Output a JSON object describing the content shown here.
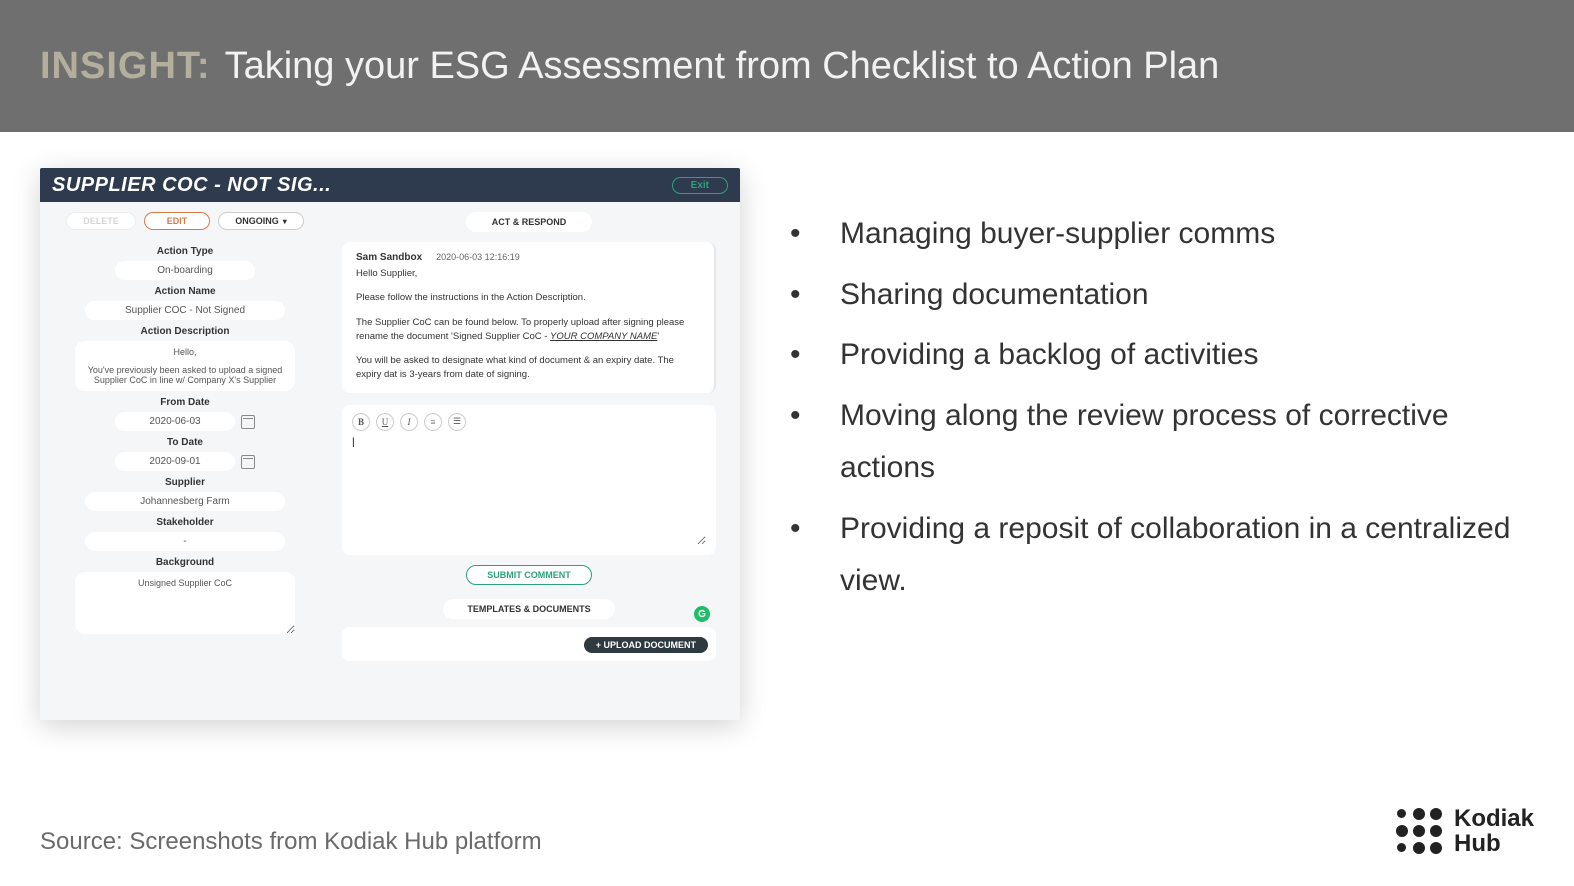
{
  "header": {
    "insight_label": "INSIGHT:",
    "headline": "Taking your ESG Assessment from Checklist to Action Plan"
  },
  "screenshot": {
    "window_title": "SUPPLIER COC - NOT SIG...",
    "exit_label": "Exit",
    "buttons": {
      "delete": "DELETE",
      "edit": "EDIT",
      "ongoing": "ONGOING"
    },
    "fields": {
      "action_type_label": "Action Type",
      "action_type_value": "On-boarding",
      "action_name_label": "Action Name",
      "action_name_value": "Supplier COC - Not Signed",
      "action_description_label": "Action Description",
      "action_description_line1": "Hello,",
      "action_description_line2": "You've previously been asked to upload a signed Supplier CoC in line w/ Company X's Supplier",
      "from_date_label": "From Date",
      "from_date_value": "2020-06-03",
      "to_date_label": "To Date",
      "to_date_value": "2020-09-01",
      "supplier_label": "Supplier",
      "supplier_value": "Johannesberg Farm",
      "stakeholder_label": "Stakeholder",
      "stakeholder_value": "-",
      "background_label": "Background",
      "background_value": "Unsigned Supplier CoC"
    },
    "act_respond_tab": "ACT & RESPOND",
    "message": {
      "author": "Sam Sandbox",
      "timestamp": "2020-06-03 12:16:19",
      "line1": "Hello Supplier,",
      "line2": "Please follow the instructions in the Action Description.",
      "line3a": "The Supplier CoC can be found below. To properly upload after signing please rename the document 'Signed Supplier CoC - ",
      "line3b": "YOUR COMPANY NAME",
      "line3c": "'",
      "line4": "You will be asked to designate what kind of document & an expiry date. The expiry dat is 3-years from date of signing."
    },
    "editor": {
      "cursor": "|",
      "grammarly_glyph": "G"
    },
    "submit_label": "SUBMIT COMMENT",
    "templates_tab": "TEMPLATES & DOCUMENTS",
    "upload_label": "+ UPLOAD DOCUMENT"
  },
  "bullets": [
    "Managing buyer-supplier comms",
    "Sharing documentation",
    "Providing a backlog of activities",
    "Moving along the review process of corrective actions",
    "Providing a reposit of collaboration in a centralized view."
  ],
  "footer": {
    "source": "Source: Screenshots from Kodiak Hub platform",
    "logo_line1": "Kodiak",
    "logo_line2": "Hub"
  }
}
